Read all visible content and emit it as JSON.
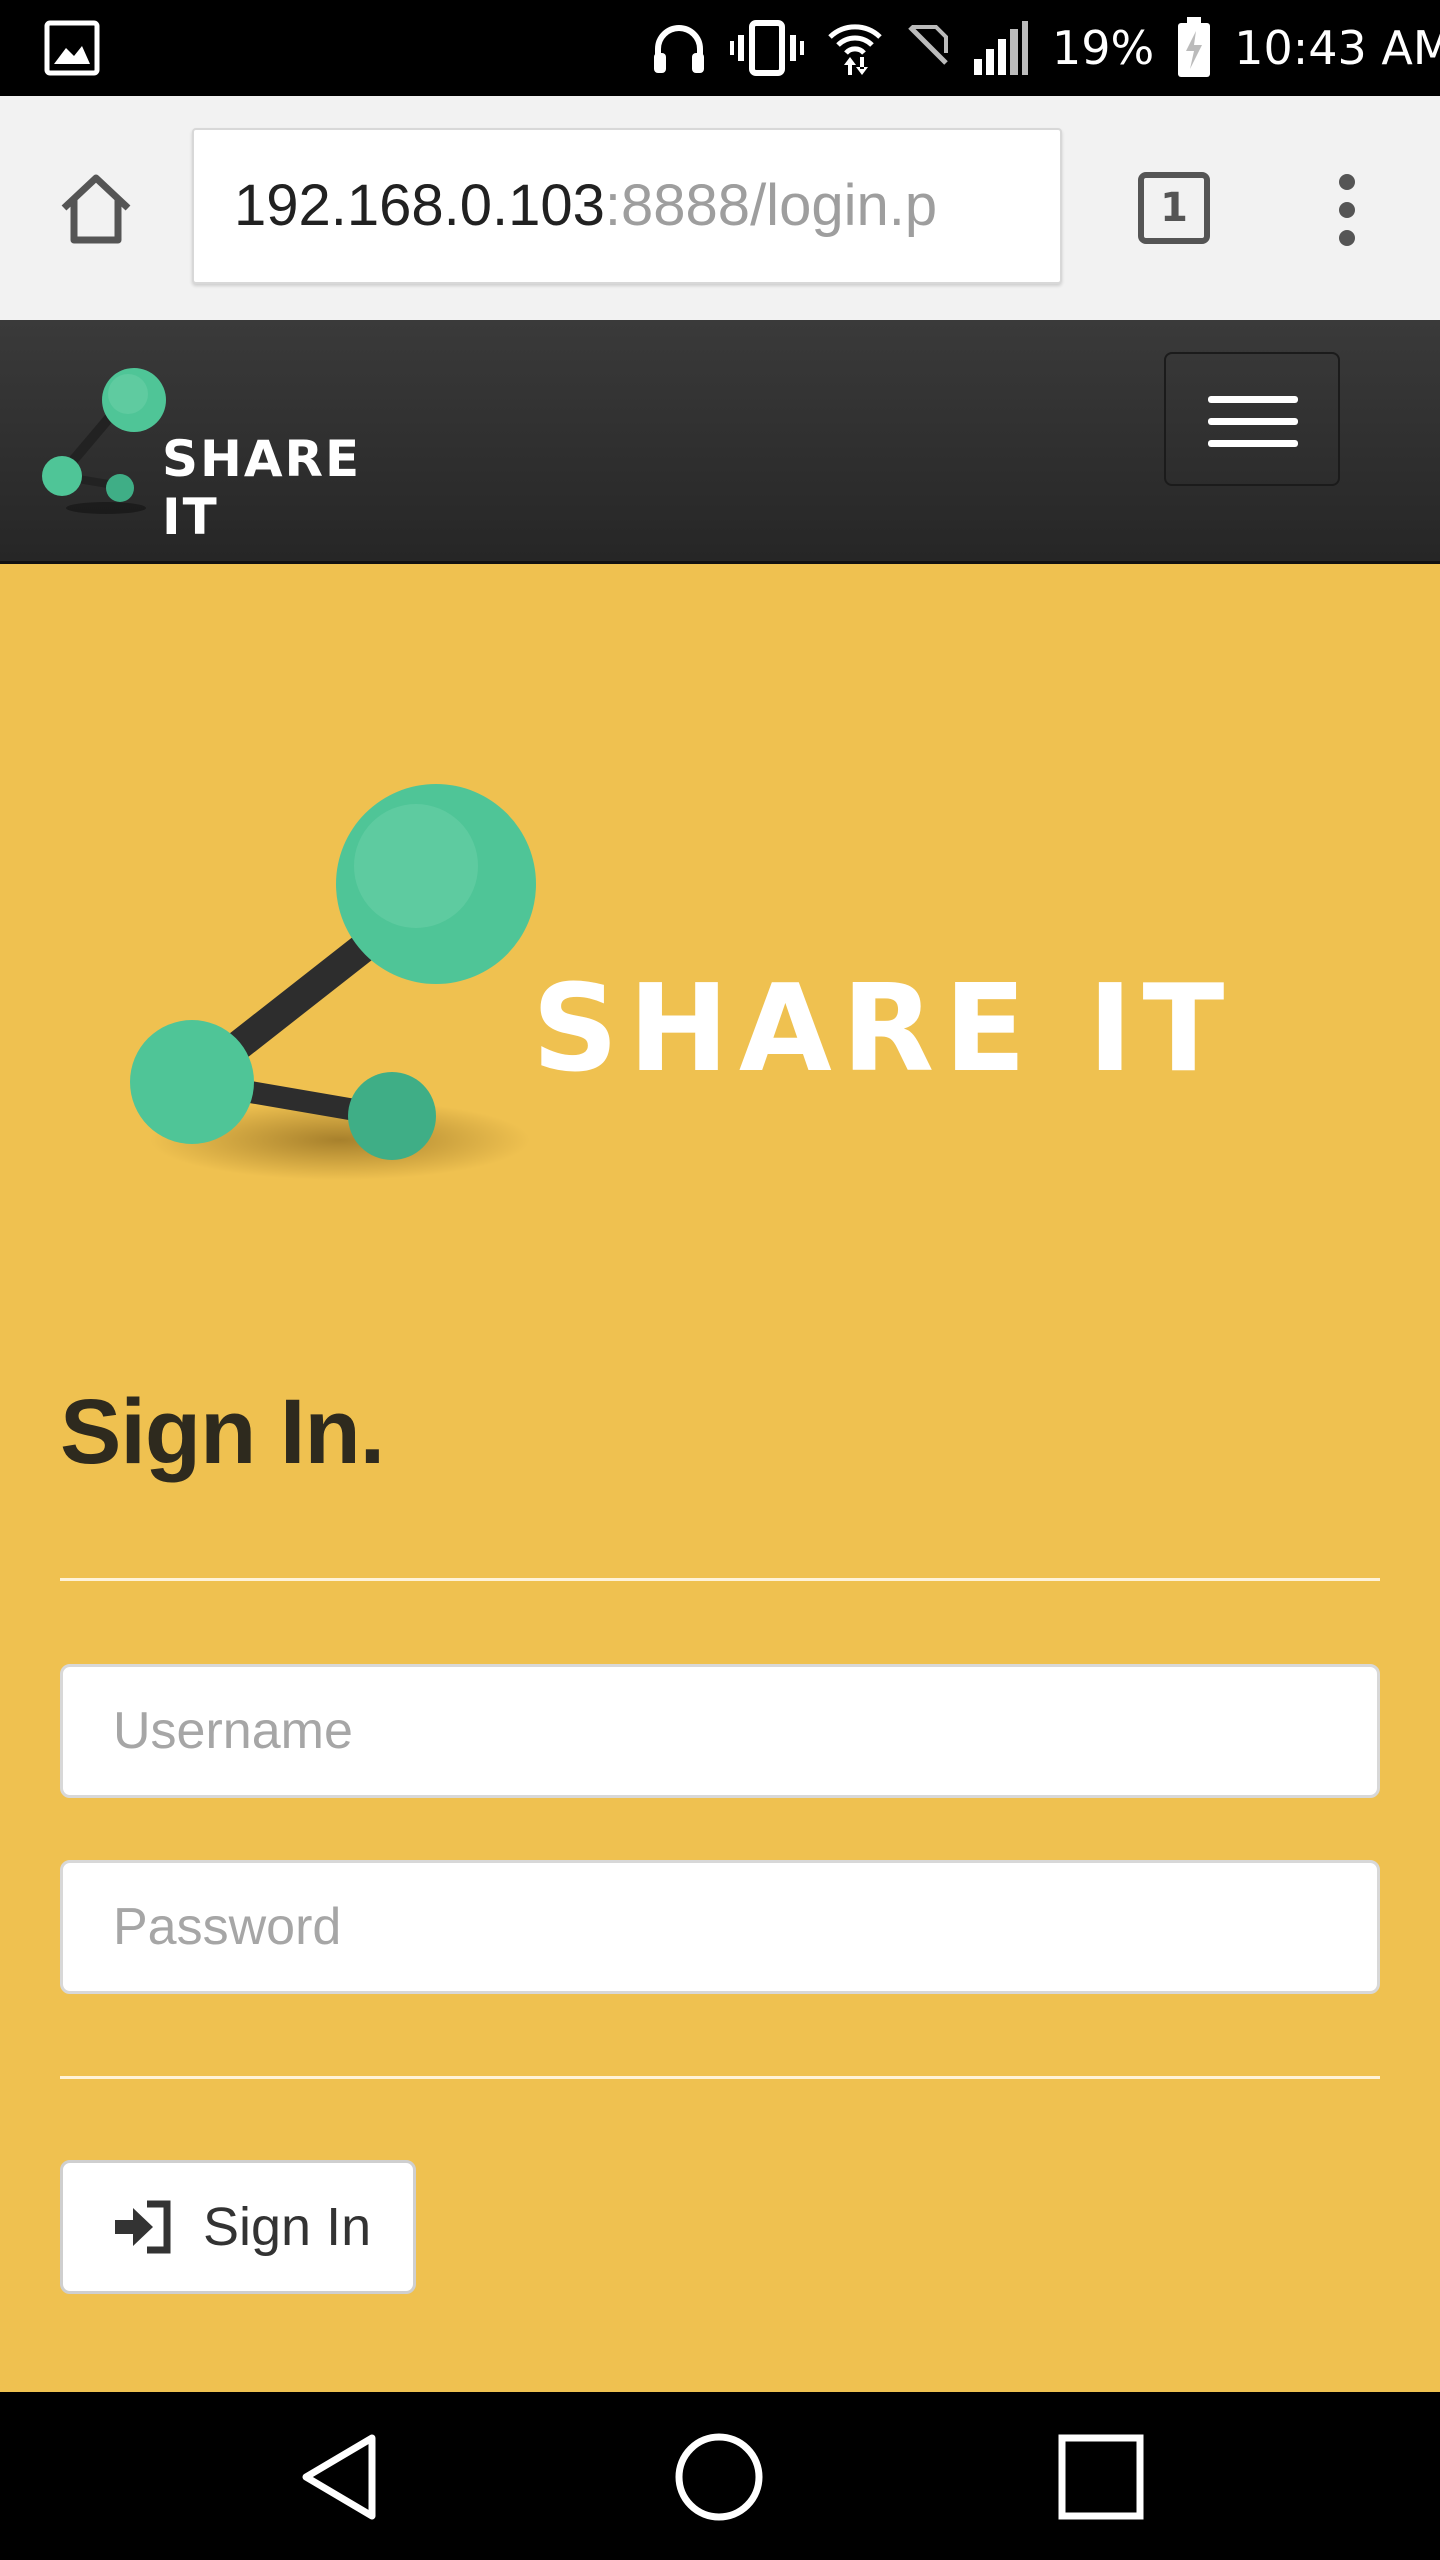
{
  "status_bar": {
    "battery": "19%",
    "time": "10:43 AM",
    "icons": [
      "gallery-icon",
      "headphones-icon",
      "vibrate-icon",
      "wifi-icon",
      "no-sim-icon",
      "signal-icon",
      "battery-charging-icon"
    ]
  },
  "browser": {
    "url_host": "192.168.0.103",
    "url_path": ":8888/login.p",
    "tab_count": "1",
    "icons": [
      "home-icon",
      "tabs-icon",
      "overflow-menu-icon"
    ]
  },
  "navbar": {
    "brand": "SHARE IT",
    "icons": [
      "share-logo-icon",
      "hamburger-menu-icon"
    ]
  },
  "hero": {
    "brand": "SHARE IT"
  },
  "form": {
    "title": "Sign In.",
    "username_placeholder": "Username",
    "password_placeholder": "Password",
    "submit_label": "Sign In",
    "submit_icon": "sign-in-icon"
  },
  "android_nav": {
    "icons": [
      "back-icon",
      "home-circle-icon",
      "recents-icon"
    ]
  },
  "colors": {
    "page_background": "#efc150",
    "navbar_background": "#2f2f2f",
    "logo_green": "#4fc597",
    "logo_stick": "#2d2d2d"
  }
}
